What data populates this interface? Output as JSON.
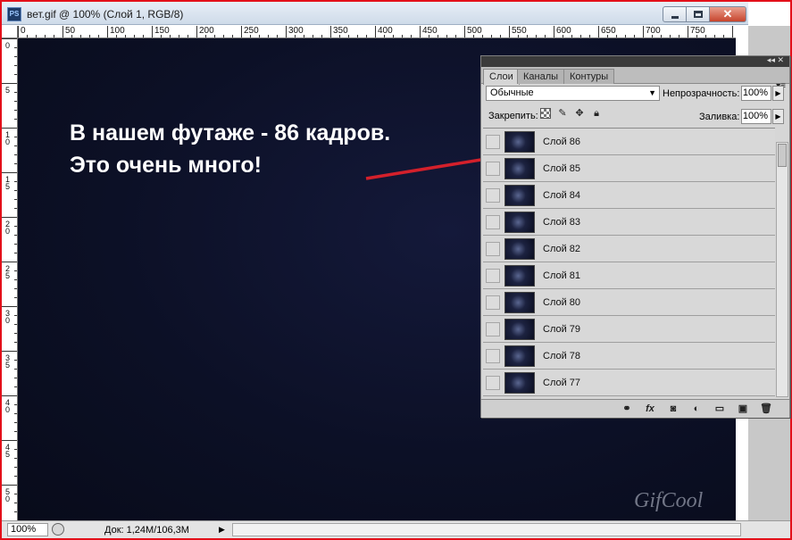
{
  "window": {
    "app_icon": "PS",
    "title": "вет.gif @ 100% (Слой 1, RGB/8)"
  },
  "rulers": {
    "top": [
      "0",
      "50",
      "100",
      "150",
      "200",
      "250",
      "300",
      "350",
      "400",
      "450",
      "500",
      "550",
      "600",
      "650",
      "700",
      "750"
    ],
    "left": [
      "0",
      "5",
      "10",
      "15",
      "20",
      "25",
      "30",
      "35",
      "40",
      "45",
      "50"
    ]
  },
  "canvas": {
    "caption_line1": "В нашем футаже - 86 кадров.",
    "caption_line2": "Это очень много!",
    "watermark": "GifCool",
    "arrow_color": "#d4202b"
  },
  "panel": {
    "tabs": [
      "Слои",
      "Каналы",
      "Контуры"
    ],
    "active_tab": "Слои",
    "blend_mode": "Обычные",
    "opacity_label": "Непрозрачность:",
    "opacity_value": "100%",
    "lock_label": "Закрепить:",
    "fill_label": "Заливка:",
    "fill_value": "100%",
    "layers": [
      "Слой 86",
      "Слой 85",
      "Слой 84",
      "Слой 83",
      "Слой 82",
      "Слой 81",
      "Слой 80",
      "Слой 79",
      "Слой 78",
      "Слой 77"
    ]
  },
  "status": {
    "zoom": "100%",
    "doc": "Док: 1,24M/106,3M"
  }
}
